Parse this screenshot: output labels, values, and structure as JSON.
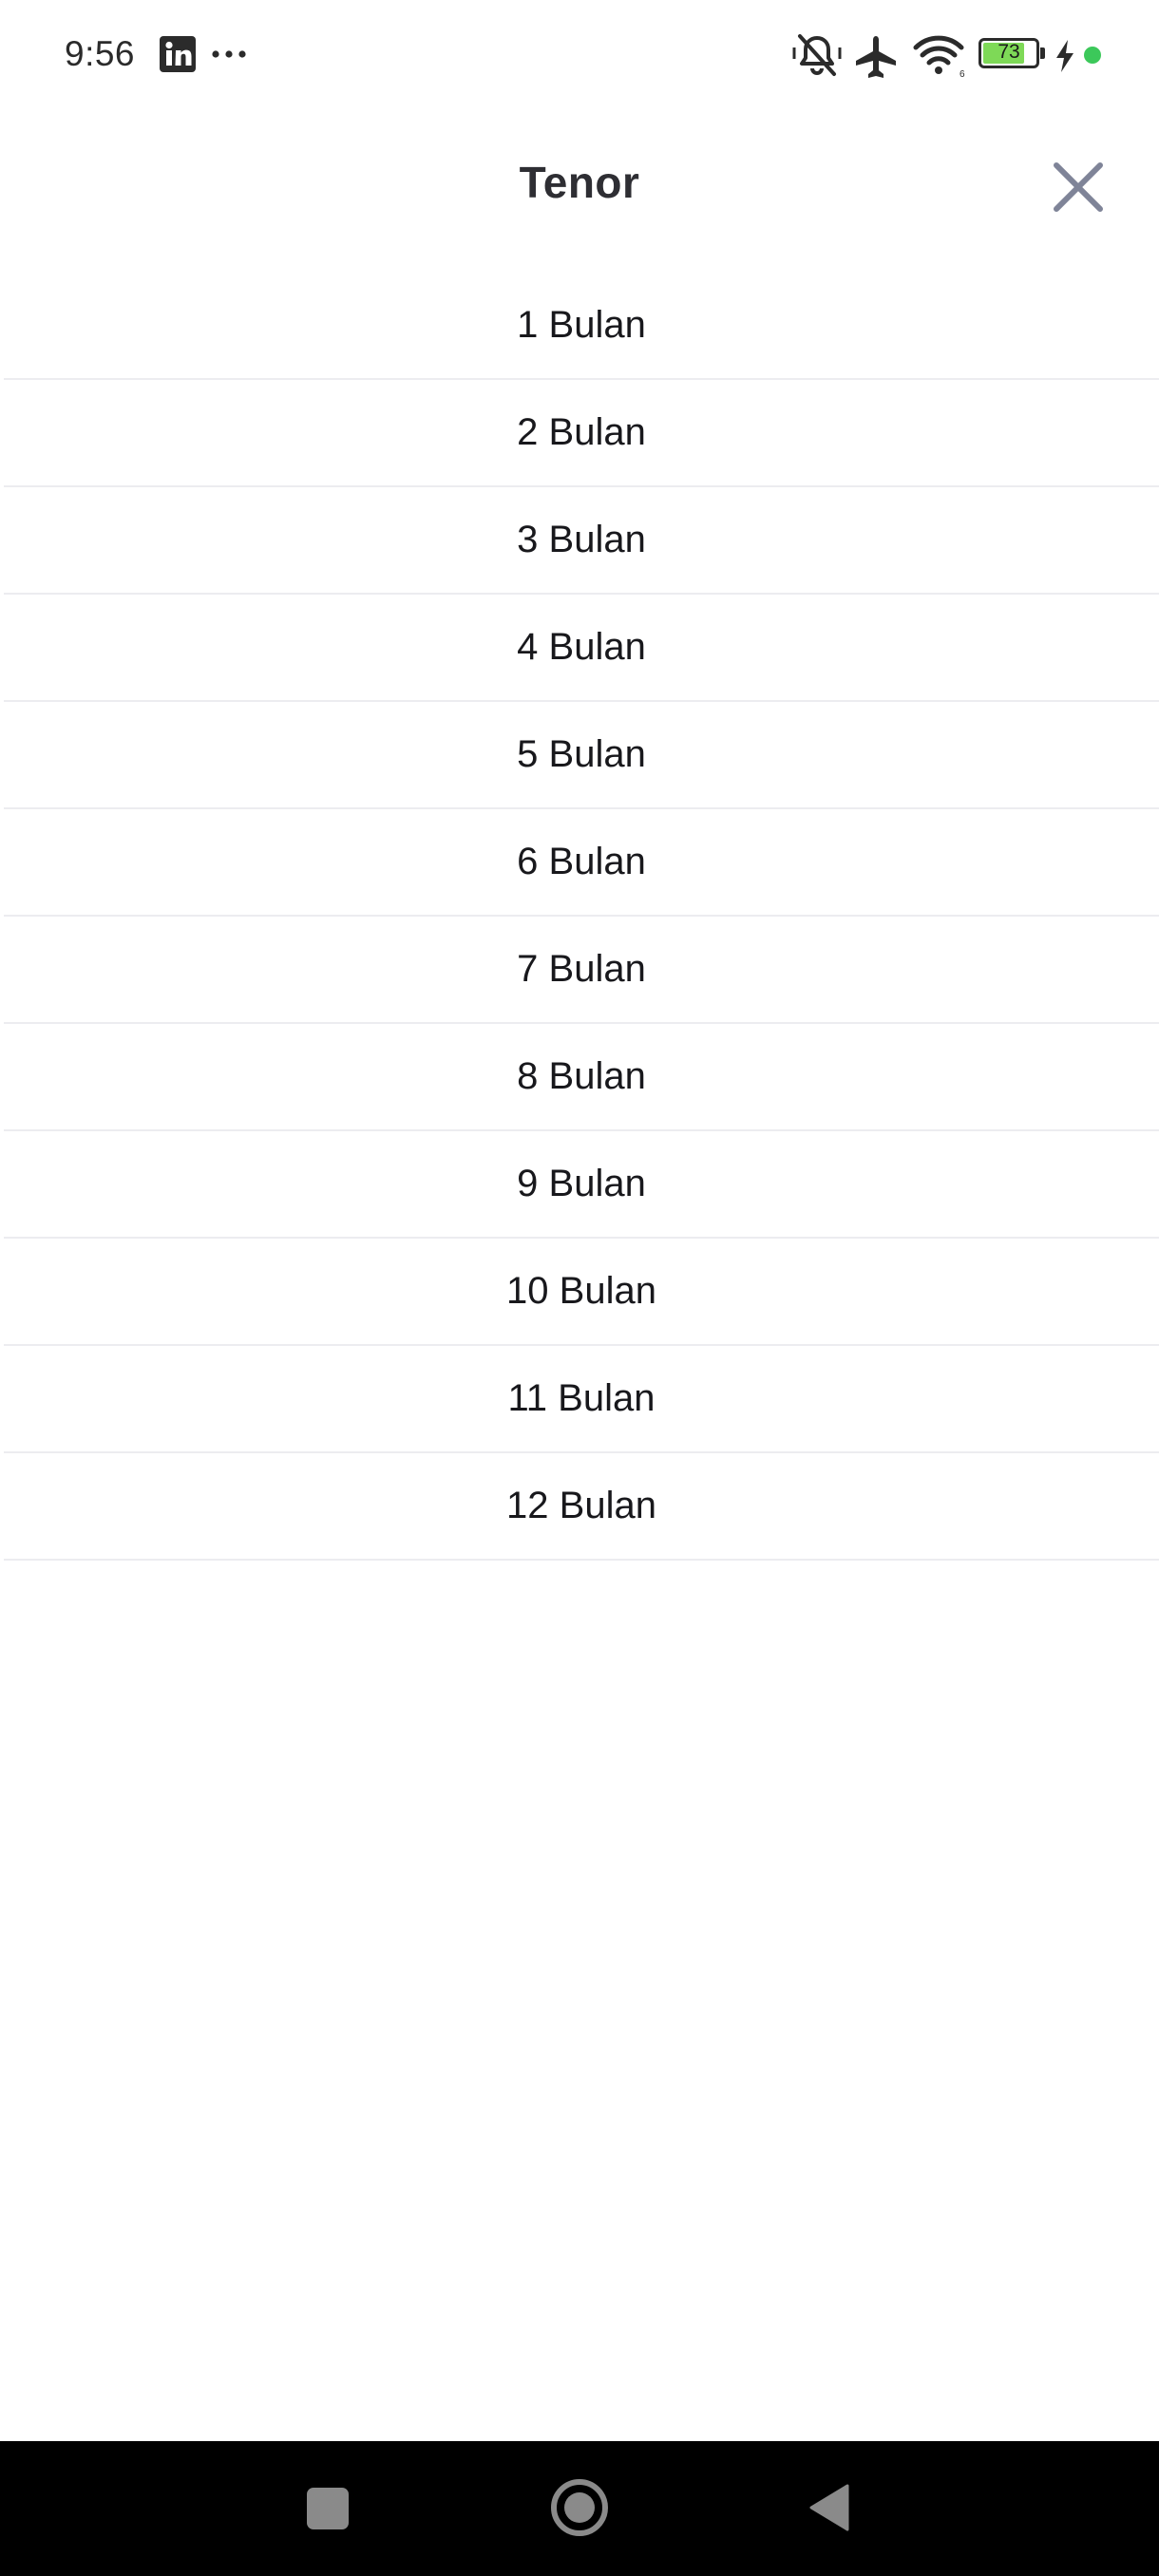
{
  "status_bar": {
    "time": "9:56",
    "battery_level": "73",
    "icons": [
      "linkedin-icon",
      "more-dots-icon",
      "mute-icon",
      "airplane-mode-icon",
      "wifi-icon",
      "battery-icon",
      "charging-icon",
      "privacy-dot-icon"
    ],
    "battery_color": "#7ed957",
    "privacy_dot_color": "#3cc85a"
  },
  "sheet": {
    "title": "Tenor",
    "close_icon": "close-icon",
    "close_color": "#7f8498"
  },
  "tenor_options": [
    {
      "label": "1 Bulan"
    },
    {
      "label": "2 Bulan"
    },
    {
      "label": "3 Bulan"
    },
    {
      "label": "4 Bulan"
    },
    {
      "label": "5 Bulan"
    },
    {
      "label": "6 Bulan"
    },
    {
      "label": "7 Bulan"
    },
    {
      "label": "8 Bulan"
    },
    {
      "label": "9 Bulan"
    },
    {
      "label": "10 Bulan"
    },
    {
      "label": "11 Bulan"
    },
    {
      "label": "12 Bulan"
    }
  ],
  "nav_bar": {
    "buttons": [
      "recents-square-icon",
      "home-circle-icon",
      "back-triangle-icon"
    ]
  }
}
